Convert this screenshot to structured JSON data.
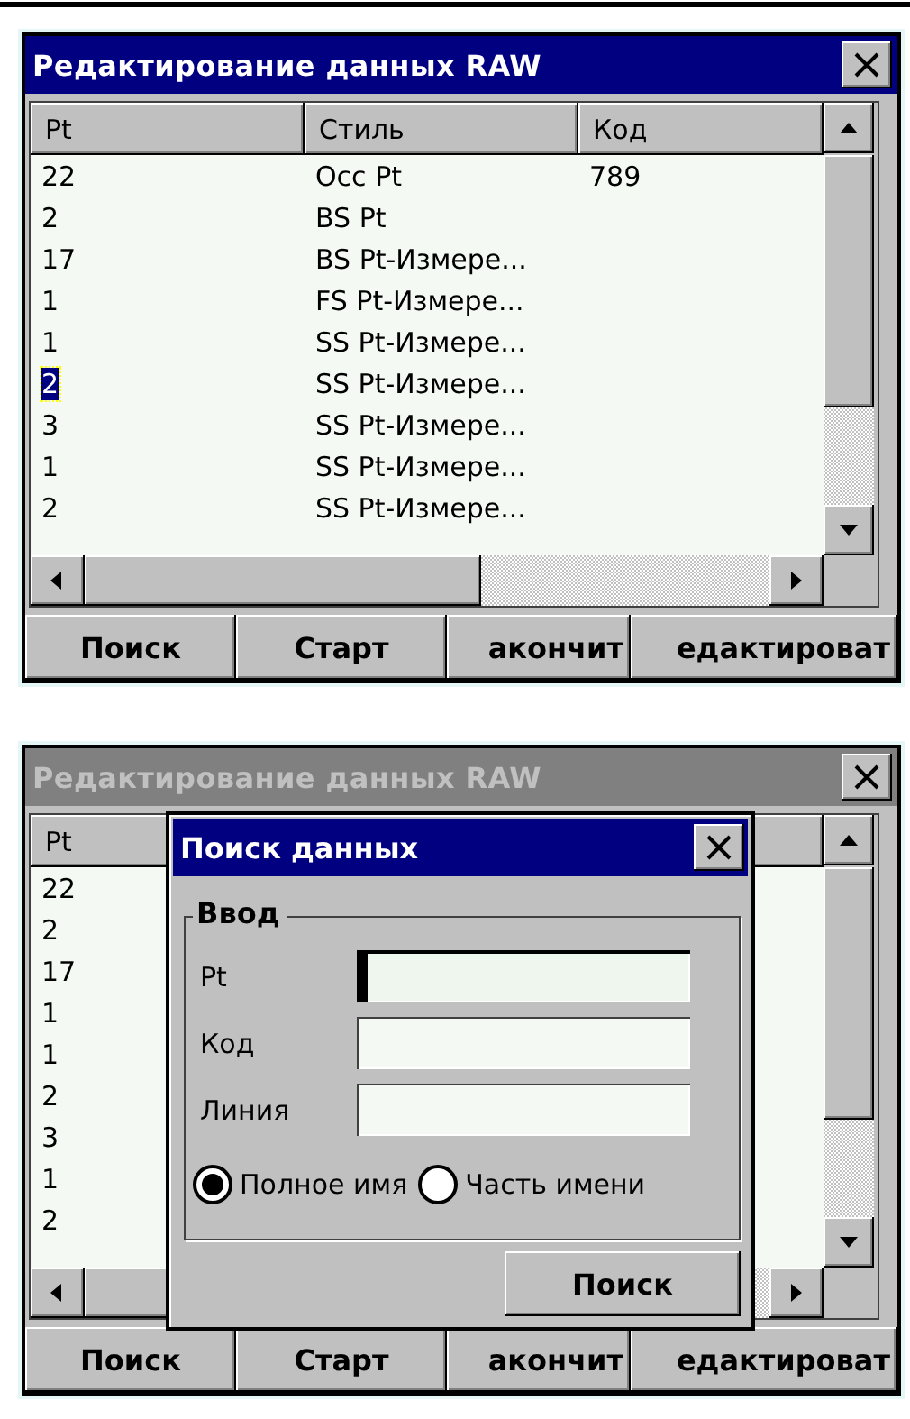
{
  "screens": [
    {
      "title": "Редактирование данных RAW",
      "active": true,
      "columns": [
        "Pt",
        "Стиль",
        "Код"
      ],
      "rows": [
        {
          "pt": "22",
          "style": "Occ Pt",
          "code": "789",
          "selected": false
        },
        {
          "pt": "2",
          "style": "BS Pt",
          "selected": false
        },
        {
          "pt": "17",
          "style": "BS Pt-Измере...",
          "selected": false
        },
        {
          "pt": "1",
          "style": "FS Pt-Измере...",
          "selected": false
        },
        {
          "pt": "1",
          "style": "SS Pt-Измере...",
          "selected": false
        },
        {
          "pt": "2",
          "style": "SS Pt-Измере...",
          "selected": true
        },
        {
          "pt": "3",
          "style": "SS Pt-Измере...",
          "selected": false
        },
        {
          "pt": "1",
          "style": "SS Pt-Измере...",
          "selected": false
        },
        {
          "pt": "2",
          "style": "SS Pt-Измере...",
          "selected": false
        }
      ],
      "buttons": [
        "Поиск",
        "Старт",
        "акончит",
        "едактироват"
      ]
    },
    {
      "title": "Редактирование данных RAW",
      "active": false,
      "columns": [
        "Pt"
      ],
      "rows": [
        {
          "pt": "22",
          "selected": false
        },
        {
          "pt": "2",
          "selected": false
        },
        {
          "pt": "17",
          "selected": false
        },
        {
          "pt": "1",
          "selected": false
        },
        {
          "pt": "1",
          "selected": false
        },
        {
          "pt": "2",
          "selected": false
        },
        {
          "pt": "3",
          "selected": false
        },
        {
          "pt": "1",
          "selected": false
        },
        {
          "pt": "2",
          "selected": false
        }
      ],
      "buttons": [
        "Поиск",
        "Старт",
        "акончит",
        "едактироват"
      ],
      "dialog": {
        "title": "Поиск данных",
        "group": "Ввод",
        "fields": [
          {
            "label": "Pt",
            "focused": true
          },
          {
            "label": "Код",
            "focused": false
          },
          {
            "label": "Линия",
            "focused": false
          }
        ],
        "radios": [
          {
            "label": "Полное имя",
            "selected": true
          },
          {
            "label": "Часть имени",
            "selected": false
          }
        ],
        "button": "Поиск"
      }
    }
  ]
}
